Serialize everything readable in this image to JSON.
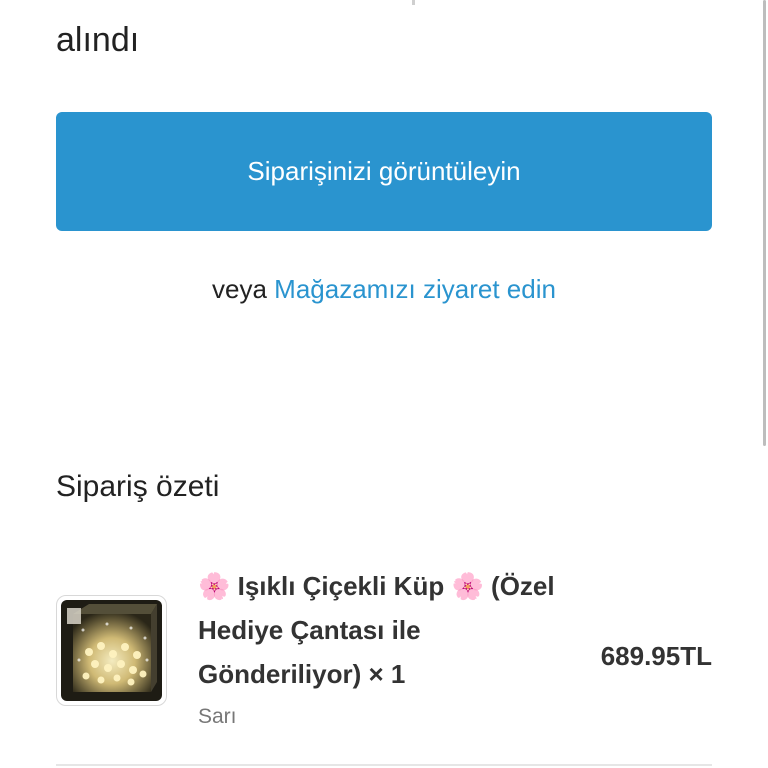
{
  "header": {
    "title_fragment": "alındı"
  },
  "actions": {
    "view_order_label": "Siparişinizi görüntüleyin",
    "or_text": "veya",
    "visit_store_link": "Mağazamızı ziyaret edin"
  },
  "summary": {
    "title": "Sipariş özeti",
    "items": [
      {
        "name": "🌸 Işıklı Çiçekli Küp 🌸 (Özel Hediye Çantası ile Gönderiliyor) × 1",
        "variant": "Sarı",
        "price": "689.95TL",
        "thumbnail_icon": "product-image-icon"
      }
    ]
  },
  "colors": {
    "accent": "#2a94cf",
    "text": "#222222",
    "muted": "#777777"
  }
}
